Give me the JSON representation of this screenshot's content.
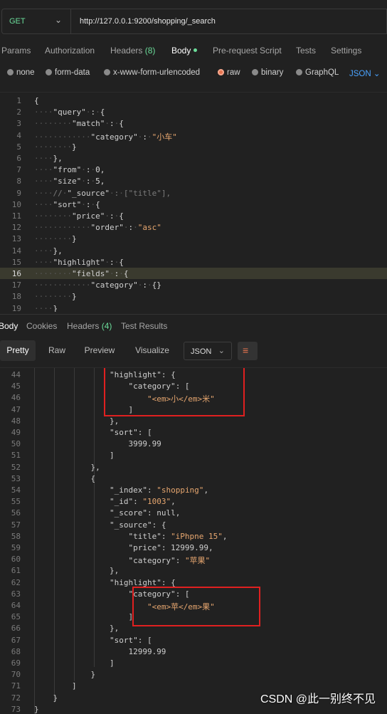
{
  "request": {
    "method": "GET",
    "url": "http://127.0.0.1:9200/shopping/_search"
  },
  "request_tabs": [
    {
      "label": "Params"
    },
    {
      "label": "Authorization"
    },
    {
      "label": "Headers",
      "count": "(8)"
    },
    {
      "label": "Body",
      "active": true
    },
    {
      "label": "Pre-request Script"
    },
    {
      "label": "Tests"
    },
    {
      "label": "Settings"
    }
  ],
  "body_types": [
    {
      "label": "none"
    },
    {
      "label": "form-data"
    },
    {
      "label": "x-www-form-urlencoded"
    },
    {
      "label": "raw",
      "selected": true
    },
    {
      "label": "binary"
    },
    {
      "label": "GraphQL"
    },
    {
      "label": "JSON"
    }
  ],
  "editor_lines": [
    {
      "n": "1",
      "text": "{"
    },
    {
      "n": "2",
      "text": "····\"query\"·:·{"
    },
    {
      "n": "3",
      "text": "········\"match\"·:·{"
    },
    {
      "n": "4",
      "text": "············\"category\"·:·\"小车\""
    },
    {
      "n": "5",
      "text": "········}"
    },
    {
      "n": "6",
      "text": "····},"
    },
    {
      "n": "7",
      "text": "····\"from\"·:·0,"
    },
    {
      "n": "8",
      "text": "····\"size\"·:·5,"
    },
    {
      "n": "9",
      "text": "····//·\"_source\"·:·[\"title\"],"
    },
    {
      "n": "10",
      "text": "····\"sort\"·:·{"
    },
    {
      "n": "11",
      "text": "········\"price\"·:·{"
    },
    {
      "n": "12",
      "text": "············\"order\"·:·\"asc\""
    },
    {
      "n": "13",
      "text": "········}"
    },
    {
      "n": "14",
      "text": "····},"
    },
    {
      "n": "15",
      "text": "····\"highlight\"·:·{"
    },
    {
      "n": "16",
      "text": "········\"fields\"·:·{"
    },
    {
      "n": "17",
      "text": "············\"category\"·:·{}"
    },
    {
      "n": "18",
      "text": "········}"
    },
    {
      "n": "19",
      "text": "····}"
    }
  ],
  "response_tabs": [
    {
      "label": "Body",
      "active": true
    },
    {
      "label": "Cookies"
    },
    {
      "label": "Headers",
      "count": "(4)"
    },
    {
      "label": "Test Results"
    }
  ],
  "view_modes": [
    "Pretty",
    "Raw",
    "Preview",
    "Visualize"
  ],
  "format": "JSON",
  "response_lines": [
    {
      "n": "44",
      "text": "                \"highlight\": {"
    },
    {
      "n": "45",
      "text": "                    \"category\": ["
    },
    {
      "n": "46",
      "text": "                        \"<em>小</em>米\""
    },
    {
      "n": "47",
      "text": "                    ]"
    },
    {
      "n": "48",
      "text": "                },"
    },
    {
      "n": "49",
      "text": "                \"sort\": ["
    },
    {
      "n": "50",
      "text": "                    3999.99"
    },
    {
      "n": "51",
      "text": "                ]"
    },
    {
      "n": "52",
      "text": "            },"
    },
    {
      "n": "53",
      "text": "            {"
    },
    {
      "n": "54",
      "text": "                \"_index\": \"shopping\","
    },
    {
      "n": "55",
      "text": "                \"_id\": \"1003\","
    },
    {
      "n": "56",
      "text": "                \"_score\": null,"
    },
    {
      "n": "57",
      "text": "                \"_source\": {"
    },
    {
      "n": "58",
      "text": "                    \"title\": \"iPhpne 15\","
    },
    {
      "n": "59",
      "text": "                    \"price\": 12999.99,"
    },
    {
      "n": "60",
      "text": "                    \"category\": \"苹果\""
    },
    {
      "n": "61",
      "text": "                },"
    },
    {
      "n": "62",
      "text": "                \"highlight\": {"
    },
    {
      "n": "63",
      "text": "                    \"category\": ["
    },
    {
      "n": "64",
      "text": "                        \"<em>苹</em>果\""
    },
    {
      "n": "65",
      "text": "                    ]"
    },
    {
      "n": "66",
      "text": "                },"
    },
    {
      "n": "67",
      "text": "                \"sort\": ["
    },
    {
      "n": "68",
      "text": "                    12999.99"
    },
    {
      "n": "69",
      "text": "                ]"
    },
    {
      "n": "70",
      "text": "            }"
    },
    {
      "n": "71",
      "text": "        ]"
    },
    {
      "n": "72",
      "text": "    }"
    },
    {
      "n": "73",
      "text": "}"
    }
  ],
  "watermark": "CSDN @此一别终不见",
  "colors": {
    "get": "#6bdd9a",
    "accent": "#e8744f",
    "json_link": "#4aa3ff",
    "string": "#e6a66f",
    "highlight_box": "#e02020"
  }
}
